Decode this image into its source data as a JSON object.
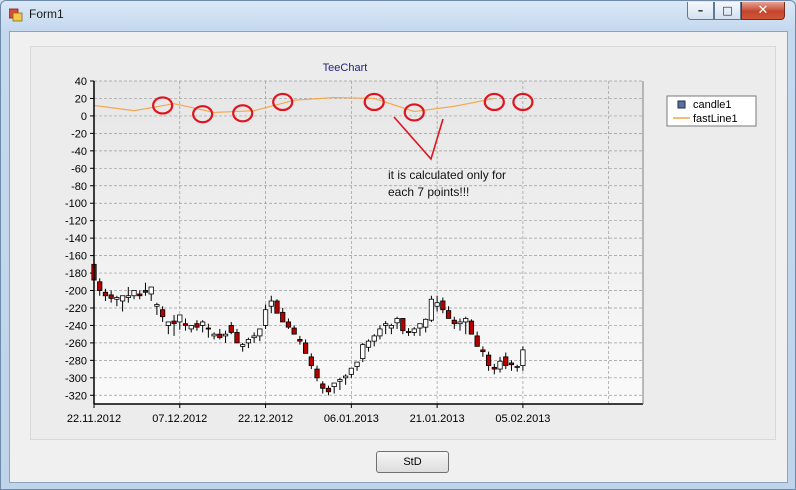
{
  "window": {
    "title": "Form1",
    "minimize_glyph": "–",
    "maximize_glyph": "□",
    "close_glyph": "✕",
    "app_icon": "form-app-icon"
  },
  "button": {
    "label": "StD"
  },
  "annotation": {
    "line1": "it is calculated only for",
    "line2": "each 7 points!!!"
  },
  "colors": {
    "bull_body": "#ffffff",
    "bear_body": "#b40000",
    "fastline": "#f5a54a",
    "marker": "#e0141e",
    "chart_title": "#1f1f7a"
  },
  "chart_data": {
    "type": "line",
    "title": "TeeChart",
    "xlabel": "",
    "ylabel": "",
    "ylim": [
      -330,
      40
    ],
    "yticks": [
      40,
      20,
      0,
      -20,
      -40,
      -60,
      -80,
      -100,
      -120,
      -140,
      -160,
      -180,
      -200,
      -220,
      -240,
      -260,
      -280,
      -300,
      -320
    ],
    "xticks": [
      "22.11.2012",
      "07.12.2012",
      "22.12.2012",
      "06.01.2013",
      "21.01.2013",
      "05.02.2013"
    ],
    "xlim": [
      "2012-11-22",
      "2013-02-26"
    ],
    "grid": true,
    "legend": {
      "placement": "right",
      "entries": [
        "candle1",
        "fastLine1"
      ]
    },
    "series": [
      {
        "name": "fastLine1",
        "type": "line",
        "x": [
          "2012-11-22",
          "2012-11-29",
          "2012-12-06",
          "2012-12-13",
          "2012-12-20",
          "2012-12-27",
          "2013-01-03",
          "2013-01-10",
          "2013-01-17",
          "2013-01-24",
          "2013-01-31"
        ],
        "y": [
          12,
          6,
          14,
          4,
          6,
          18,
          21,
          20,
          5,
          11,
          20
        ]
      },
      {
        "name": "candle1",
        "type": "candlestick",
        "x": [
          "2012-11-22",
          "2012-11-23",
          "2012-11-24",
          "2012-11-25",
          "2012-11-26",
          "2012-11-27",
          "2012-11-28",
          "2012-11-29",
          "2012-11-30",
          "2012-12-01",
          "2012-12-02",
          "2012-12-03",
          "2012-12-04",
          "2012-12-05",
          "2012-12-06",
          "2012-12-07",
          "2012-12-08",
          "2012-12-09",
          "2012-12-10",
          "2012-12-11",
          "2012-12-12",
          "2012-12-13",
          "2012-12-14",
          "2012-12-15",
          "2012-12-16",
          "2012-12-17",
          "2012-12-18",
          "2012-12-19",
          "2012-12-20",
          "2012-12-21",
          "2012-12-22",
          "2012-12-23",
          "2012-12-24",
          "2012-12-25",
          "2012-12-26",
          "2012-12-27",
          "2012-12-28",
          "2012-12-29",
          "2012-12-30",
          "2012-12-31",
          "2013-01-01",
          "2013-01-02",
          "2013-01-03",
          "2013-01-04",
          "2013-01-05",
          "2013-01-06",
          "2013-01-07",
          "2013-01-08",
          "2013-01-09",
          "2013-01-10",
          "2013-01-11",
          "2013-01-12",
          "2013-01-13",
          "2013-01-14",
          "2013-01-15",
          "2013-01-16",
          "2013-01-17",
          "2013-01-18",
          "2013-01-19",
          "2013-01-20",
          "2013-01-21",
          "2013-01-22",
          "2013-01-23",
          "2013-01-24",
          "2013-01-25",
          "2013-01-26",
          "2013-01-27",
          "2013-01-28",
          "2013-01-29",
          "2013-01-30",
          "2013-01-31",
          "2013-02-01",
          "2013-02-02",
          "2013-02-03",
          "2013-02-04",
          "2013-02-05"
        ],
        "open": [
          -170,
          -190,
          -202,
          -205,
          -210,
          -212,
          -208,
          -206,
          -204,
          -200,
          -204,
          -218,
          -222,
          -240,
          -235,
          -236,
          -238,
          -244,
          -238,
          -240,
          -243,
          -252,
          -250,
          -252,
          -240,
          -248,
          -264,
          -260,
          -254,
          -252,
          -240,
          -218,
          -212,
          -225,
          -236,
          -243,
          -256,
          -260,
          -276,
          -290,
          -307,
          -312,
          -310,
          -304,
          -300,
          -296,
          -287,
          -278,
          -265,
          -258,
          -252,
          -240,
          -243,
          -237,
          -232,
          -247,
          -248,
          -243,
          -242,
          -234,
          -218,
          -212,
          -223,
          -234,
          -238,
          -236,
          -235,
          -252,
          -268,
          -274,
          -288,
          -290,
          -276,
          -283,
          -288,
          -286
        ],
        "high": [
          -163,
          -186,
          -198,
          -200,
          -206,
          -210,
          -196,
          -200,
          -200,
          -191,
          -196,
          -214,
          -218,
          -238,
          -228,
          -232,
          -232,
          -240,
          -234,
          -234,
          -238,
          -248,
          -244,
          -246,
          -236,
          -244,
          -260,
          -254,
          -248,
          -244,
          -216,
          -206,
          -210,
          -220,
          -232,
          -240,
          -252,
          -256,
          -272,
          -286,
          -304,
          -309,
          -306,
          -300,
          -296,
          -290,
          -282,
          -260,
          -256,
          -250,
          -240,
          -235,
          -238,
          -230,
          -232,
          -243,
          -242,
          -238,
          -232,
          -206,
          -206,
          -208,
          -218,
          -230,
          -232,
          -230,
          -233,
          -247,
          -264,
          -270,
          -284,
          -276,
          -271,
          -280,
          -285,
          -264
        ],
        "low": [
          -190,
          -206,
          -212,
          -214,
          -218,
          -224,
          -214,
          -210,
          -210,
          -206,
          -212,
          -228,
          -236,
          -250,
          -252,
          -245,
          -246,
          -248,
          -246,
          -248,
          -254,
          -256,
          -256,
          -260,
          -250,
          -260,
          -270,
          -266,
          -260,
          -258,
          -244,
          -226,
          -220,
          -234,
          -244,
          -250,
          -262,
          -268,
          -290,
          -304,
          -318,
          -320,
          -318,
          -314,
          -308,
          -300,
          -292,
          -282,
          -270,
          -264,
          -256,
          -250,
          -250,
          -244,
          -250,
          -252,
          -252,
          -252,
          -248,
          -236,
          -224,
          -226,
          -232,
          -244,
          -246,
          -250,
          -250,
          -258,
          -276,
          -292,
          -296,
          -294,
          -290,
          -292,
          -293,
          -292
        ],
        "close": [
          -188,
          -200,
          -206,
          -209,
          -208,
          -206,
          -206,
          -200,
          -206,
          -202,
          -196,
          -216,
          -230,
          -236,
          -238,
          -228,
          -240,
          -240,
          -242,
          -236,
          -244,
          -250,
          -254,
          -250,
          -248,
          -260,
          -262,
          -256,
          -252,
          -244,
          -222,
          -212,
          -226,
          -236,
          -242,
          -250,
          -258,
          -272,
          -286,
          -300,
          -312,
          -316,
          -306,
          -302,
          -298,
          -289,
          -282,
          -262,
          -258,
          -252,
          -244,
          -238,
          -240,
          -232,
          -246,
          -248,
          -244,
          -238,
          -233,
          -210,
          -214,
          -222,
          -232,
          -238,
          -236,
          -232,
          -250,
          -264,
          -270,
          -286,
          -290,
          -281,
          -286,
          -285,
          -287,
          -268
        ]
      }
    ],
    "markers": {
      "x": [
        "2012-12-04",
        "2012-12-11",
        "2012-12-18",
        "2012-12-25",
        "2013-01-10",
        "2013-01-17",
        "2013-01-31",
        "2013-02-05"
      ],
      "y": [
        12,
        2,
        3,
        16,
        16,
        4,
        16,
        16
      ]
    }
  }
}
